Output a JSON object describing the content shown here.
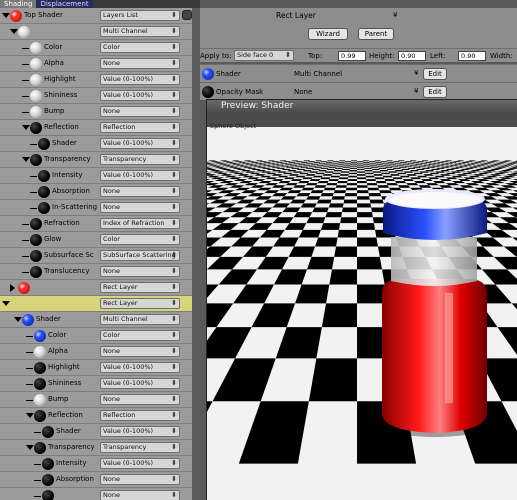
{
  "tabs": [
    "Shading",
    "Displacement"
  ],
  "tree_rows": [
    {
      "label": "Top Shader",
      "select": "Layers List",
      "ball": "red",
      "twist": "open",
      "indent": 10,
      "pin": true
    },
    {
      "label": "",
      "select": "Multi Channel",
      "ball": "white",
      "twist": "open",
      "indent": 18
    },
    {
      "label": "Color",
      "select": "Color",
      "ball": "white",
      "indent": 30
    },
    {
      "label": "Alpha",
      "select": "None",
      "ball": "white",
      "indent": 30
    },
    {
      "label": "Highlight",
      "select": "Value (0-100%)",
      "ball": "white",
      "indent": 30
    },
    {
      "label": "Shininess",
      "select": "Value (0-100%)",
      "ball": "white",
      "indent": 30
    },
    {
      "label": "Bump",
      "select": "None",
      "ball": "white",
      "indent": 30
    },
    {
      "label": "Reflection",
      "select": "Reflection",
      "ball": "black",
      "twist": "open",
      "indent": 30
    },
    {
      "label": "Shader",
      "select": "Value (0-100%)",
      "ball": "black",
      "indent": 38
    },
    {
      "label": "Transparency",
      "select": "Transparency",
      "ball": "black",
      "twist": "open",
      "indent": 30
    },
    {
      "label": "Intensity",
      "select": "Value (0-100%)",
      "ball": "black",
      "indent": 38
    },
    {
      "label": "Absorption",
      "select": "None",
      "ball": "black",
      "indent": 38
    },
    {
      "label": "In-Scattering",
      "select": "None",
      "ball": "black",
      "indent": 38
    },
    {
      "label": "Refraction",
      "select": "Index of Refraction",
      "ball": "black",
      "indent": 30
    },
    {
      "label": "Glow",
      "select": "Color",
      "ball": "black",
      "indent": 30
    },
    {
      "label": "Subsurface Sc",
      "select": "SubSurface Scattering",
      "ball": "black",
      "indent": 30
    },
    {
      "label": "Translucency",
      "select": "None",
      "ball": "black",
      "indent": 30
    },
    {
      "label": "",
      "select": "Rect Layer",
      "ball": "red",
      "twist": "closed",
      "indent": 18
    },
    {
      "label": "",
      "select": "Rect Layer",
      "ball": "",
      "twist": "open",
      "indent": 10,
      "highlight": true
    },
    {
      "label": "Shader",
      "select": "Multi Channel",
      "ball": "blue",
      "twist": "open",
      "indent": 22
    },
    {
      "label": "Color",
      "select": "Color",
      "ball": "blue",
      "indent": 34
    },
    {
      "label": "Alpha",
      "select": "None",
      "ball": "white",
      "indent": 34
    },
    {
      "label": "Highlight",
      "select": "Value (0-100%)",
      "ball": "black",
      "indent": 34
    },
    {
      "label": "Shininess",
      "select": "Value (0-100%)",
      "ball": "black",
      "indent": 34
    },
    {
      "label": "Bump",
      "select": "None",
      "ball": "white",
      "indent": 34
    },
    {
      "label": "Reflection",
      "select": "Reflection",
      "ball": "black",
      "twist": "open",
      "indent": 34
    },
    {
      "label": "Shader",
      "select": "Value (0-100%)",
      "ball": "black",
      "indent": 42
    },
    {
      "label": "Transparency",
      "select": "Transparency",
      "ball": "black",
      "twist": "open",
      "indent": 34
    },
    {
      "label": "Intensity",
      "select": "Value (0-100%)",
      "ball": "black",
      "indent": 42
    },
    {
      "label": "Absorption",
      "select": "None",
      "ball": "black",
      "indent": 42
    },
    {
      "label": "",
      "select": "None",
      "ball": "black",
      "indent": 42
    }
  ],
  "header": {
    "title": "Rect Layer",
    "wizard_label": "Wizard",
    "parent_label": "Parent"
  },
  "apply": {
    "apply_to_label": "Apply to:",
    "apply_to_value": "Side face 0",
    "top_label": "Top:",
    "top_value": "0.99",
    "height_label": "Height:",
    "height_value": "0.90",
    "left_label": "Left:",
    "left_value": "0.90",
    "width_label": "Width:"
  },
  "props": [
    {
      "label": "Shader",
      "value": "Multi Channel",
      "button": "Edit",
      "ball": "blue"
    },
    {
      "label": "Opacity Mask",
      "value": "None",
      "button": "Edit",
      "ball": "black"
    }
  ],
  "preview": {
    "title": "Preview: Shader",
    "object_label": "Sphere Object"
  },
  "colors": {
    "panel": "#9b9b9b",
    "highlight_row": "#d8d47a",
    "bottle_red": "#e00000",
    "cap_blue": "#1e3cd0"
  }
}
